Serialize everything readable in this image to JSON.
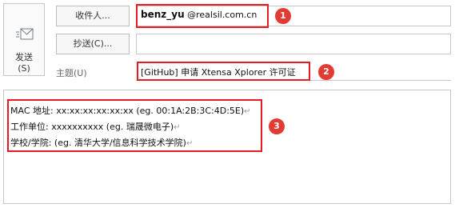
{
  "compose": {
    "send_label": "发送",
    "send_shortcut": "(S)",
    "to_button": "收件人...",
    "cc_button": "抄送(C)...",
    "subject_label": "主题(U)"
  },
  "to": {
    "name": "benz_yu",
    "domain": "@realsil.com.cn"
  },
  "subject": "[GitHub] 申请 Xtensa Xplorer 许可证",
  "body": {
    "line1": "MAC  地址: xx:xx:xx:xx:xx:xx (eg. 00:1A:2B:3C:4D:5E)",
    "line2": "工作单位: xxxxxxxxxx (eg.  瑞晟微电子)",
    "line3": "学校/学院: (eg.  清华大学/信息科学技术学院)",
    "paragraph_mark": "↵"
  },
  "annotations": {
    "badge1": "1",
    "badge2": "2",
    "badge3": "3",
    "highlight_color": "#e51d23",
    "badge_color": "#e23b33"
  }
}
